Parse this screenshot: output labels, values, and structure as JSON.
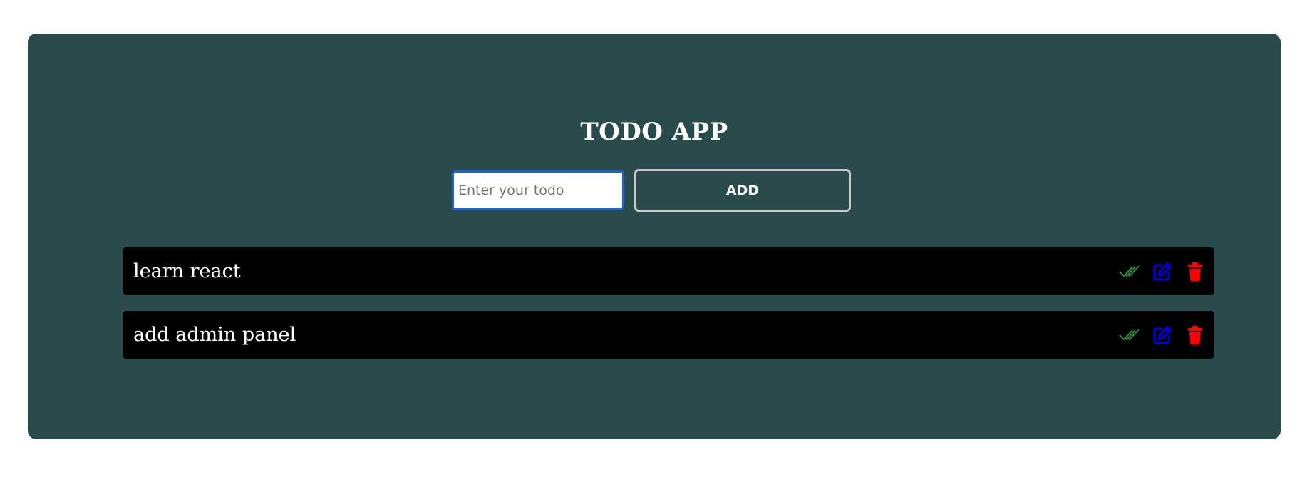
{
  "app": {
    "title": "TODO APP"
  },
  "form": {
    "input_value": "",
    "input_placeholder": "Enter your todo",
    "add_label": "ADD"
  },
  "todos": [
    {
      "text": "learn react"
    },
    {
      "text": "add admin panel"
    }
  ],
  "icons": {
    "complete": "double-check-icon",
    "edit": "edit-icon",
    "delete": "trash-icon"
  },
  "colors": {
    "card_background": "#2a4b4b",
    "todo_background": "#000000",
    "complete_icon": "#2e8b3e",
    "edit_icon": "#0000ff",
    "delete_icon": "#ff0000",
    "input_focus_border": "#1a64d8"
  }
}
